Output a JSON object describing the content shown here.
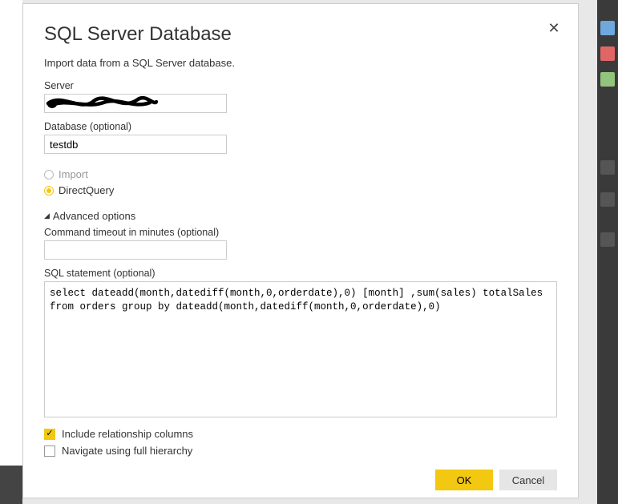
{
  "dialog": {
    "title": "SQL Server Database",
    "subtitle": "Import data from a SQL Server database.",
    "close_tooltip": "Close"
  },
  "fields": {
    "server": {
      "label": "Server",
      "value": ""
    },
    "database": {
      "label": "Database (optional)",
      "value": "testdb"
    },
    "timeout": {
      "label": "Command timeout in minutes (optional)",
      "value": ""
    },
    "sql": {
      "label": "SQL statement (optional)",
      "value": "select dateadd(month,datediff(month,0,orderdate),0) [month] ,sum(sales) totalSales from orders group by dateadd(month,datediff(month,0,orderdate),0)"
    }
  },
  "mode": {
    "import_label": "Import",
    "directquery_label": "DirectQuery",
    "selected": "directquery"
  },
  "advanced": {
    "label": "Advanced options"
  },
  "checkboxes": {
    "include_rel": {
      "label": "Include relationship columns",
      "checked": true
    },
    "full_hier": {
      "label": "Navigate using full hierarchy",
      "checked": false
    }
  },
  "buttons": {
    "ok": "OK",
    "cancel": "Cancel"
  }
}
